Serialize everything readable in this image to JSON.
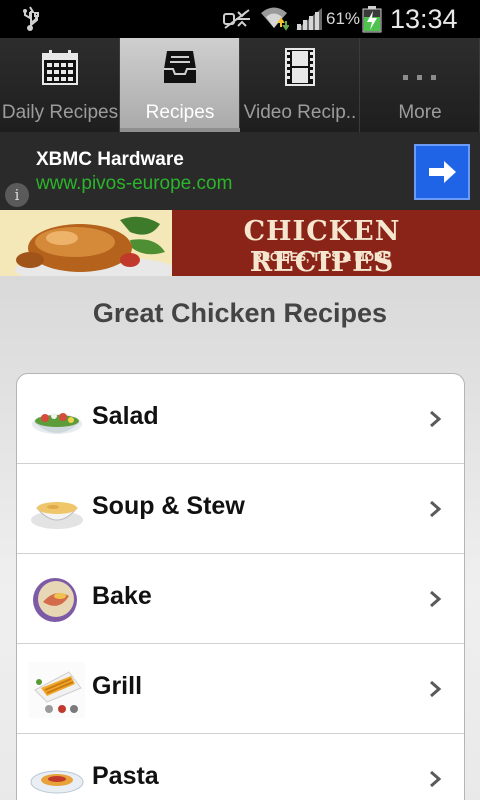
{
  "status_bar": {
    "battery_percent": "61%",
    "time": "13:34",
    "icons": [
      "usb-icon",
      "mute-icon",
      "wifi-icon",
      "signal-icon",
      "battery-icon"
    ]
  },
  "tabs": [
    {
      "label": "Daily Recipes",
      "icon": "calendar-icon",
      "active": false
    },
    {
      "label": "Recipes",
      "icon": "inbox-tray-icon",
      "active": true
    },
    {
      "label": "Video Recip..",
      "icon": "film-strip-icon",
      "active": false
    },
    {
      "label": "More",
      "icon": "more-dots-icon",
      "active": false
    }
  ],
  "ad": {
    "title": "XBMC Hardware",
    "url": "www.pivos-europe.com",
    "info": "i",
    "accent": "#1f63e6",
    "url_color": "#2bb52b"
  },
  "banner": {
    "title": "CHICKEN RECIPES",
    "subtitle": "RECIPES, TIPS & MORE"
  },
  "main": {
    "title": "Great Chicken Recipes",
    "items": [
      {
        "label": "Salad",
        "icon": "salad-bowl-icon"
      },
      {
        "label": "Soup & Stew",
        "icon": "soup-bowl-icon"
      },
      {
        "label": "Bake",
        "icon": "baked-dish-icon"
      },
      {
        "label": "Grill",
        "icon": "grill-plate-icon"
      },
      {
        "label": "Pasta",
        "icon": "pasta-plate-icon"
      }
    ]
  }
}
